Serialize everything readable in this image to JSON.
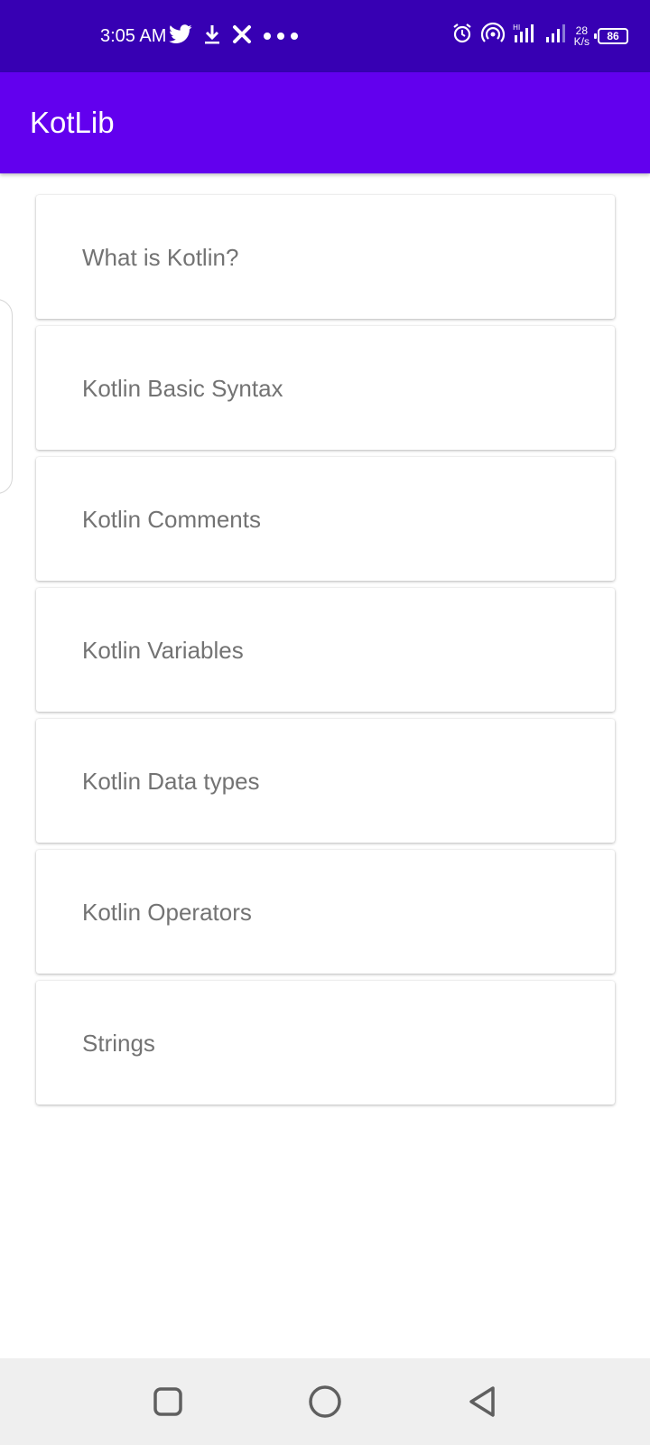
{
  "status_bar": {
    "time": "3:05 AM",
    "net_speed_value": "28",
    "net_speed_unit": "K/s",
    "battery_level": "86",
    "notification_icons": [
      "twitter-icon",
      "download-icon",
      "x-icon",
      "more-dots-icon"
    ],
    "system_icons": [
      "alarm-icon",
      "hotspot-icon",
      "volte-signal-icon",
      "signal-icon",
      "battery-icon"
    ]
  },
  "app_bar": {
    "title": "KotLib"
  },
  "topics": [
    {
      "label": "What is Kotlin?"
    },
    {
      "label": "Kotlin Basic Syntax"
    },
    {
      "label": "Kotlin Comments"
    },
    {
      "label": "Kotlin Variables"
    },
    {
      "label": "Kotlin Data types"
    },
    {
      "label": "Kotlin Operators"
    },
    {
      "label": "Strings"
    }
  ],
  "nav_bar": {
    "buttons": [
      "recents-button",
      "home-button",
      "back-button"
    ]
  },
  "colors": {
    "status_bar": "#3700B3",
    "app_bar": "#6200EE",
    "card_text": "#737373",
    "nav_bar": "#EFEFEF"
  }
}
